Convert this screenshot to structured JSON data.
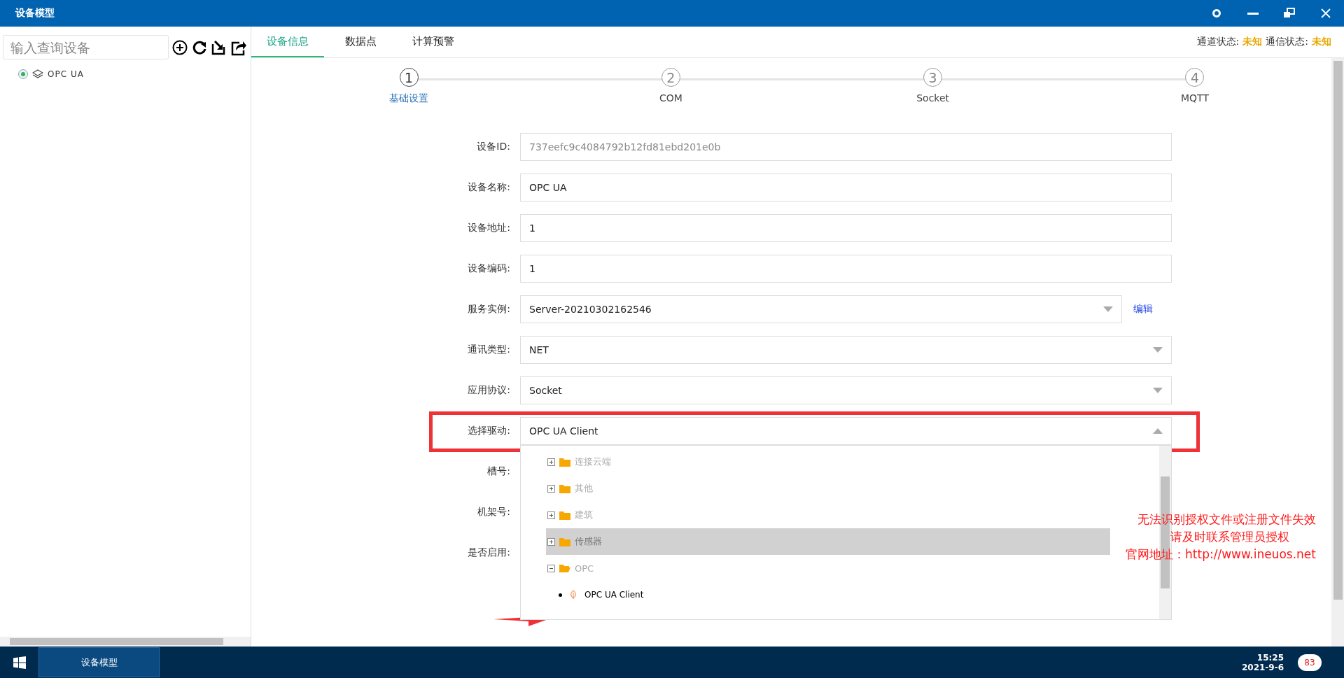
{
  "window": {
    "title": "设备模型"
  },
  "sidebar": {
    "search_placeholder": "输入查询设备",
    "tree": [
      {
        "label": "OPC UA",
        "selected": true
      }
    ]
  },
  "tabs": [
    {
      "label": "设备信息",
      "selected": true
    },
    {
      "label": "数据点",
      "selected": false
    },
    {
      "label": "计算预警",
      "selected": false
    }
  ],
  "status": [
    {
      "label": "通道状态:",
      "value": "未知"
    },
    {
      "label": "通信状态:",
      "value": "未知"
    }
  ],
  "steps": [
    {
      "number": "1",
      "label": "基础设置",
      "selected": true
    },
    {
      "number": "2",
      "label": "COM",
      "selected": false
    },
    {
      "number": "3",
      "label": "Socket",
      "selected": false
    },
    {
      "number": "4",
      "label": "MQTT",
      "selected": false
    }
  ],
  "form": [
    {
      "label": "设备ID:",
      "kind": "text",
      "value": "737eefc9c4084792b12fd81ebd201e0b",
      "disabled": true
    },
    {
      "label": "设备名称:",
      "kind": "text",
      "value": "OPC UA",
      "disabled": false
    },
    {
      "label": "设备地址:",
      "kind": "text",
      "value": "1",
      "disabled": false
    },
    {
      "label": "设备编码:",
      "kind": "text",
      "value": "1",
      "disabled": false
    },
    {
      "label": "服务实例:",
      "kind": "select",
      "value": "Server-20210302162546",
      "link": "编辑",
      "disabled": false
    },
    {
      "label": "通讯类型:",
      "kind": "select",
      "value": "NET",
      "disabled": false
    },
    {
      "label": "应用协议:",
      "kind": "select",
      "value": "Socket",
      "disabled": false
    },
    {
      "label": "选择驱动:",
      "kind": "select",
      "value": "OPC UA Client",
      "disabled": false,
      "expanded": true
    },
    {
      "label": "槽号:",
      "kind": "text"
    },
    {
      "label": "机架号:",
      "kind": "text"
    },
    {
      "label": "是否启用:",
      "kind": "text"
    }
  ],
  "driver_tree": [
    {
      "label": "连接云端",
      "expanded": false,
      "highlighted": false
    },
    {
      "label": "其他",
      "expanded": false,
      "highlighted": false
    },
    {
      "label": "建筑",
      "expanded": false,
      "highlighted": false
    },
    {
      "label": "传感器",
      "expanded": false,
      "highlighted": true
    },
    {
      "label": "OPC",
      "expanded": true,
      "highlighted": false,
      "children": [
        {
          "label": "OPC UA Client",
          "highlighted": false
        }
      ]
    }
  ],
  "license_notice": [
    "无法识别授权文件或注册文件失效",
    "请及时联系管理员授权",
    "官网地址：http://www.ineuos.net"
  ],
  "taskbar": {
    "app": "设备模型",
    "time": "15:25",
    "date": "2021-9-6",
    "notifications": "83"
  }
}
